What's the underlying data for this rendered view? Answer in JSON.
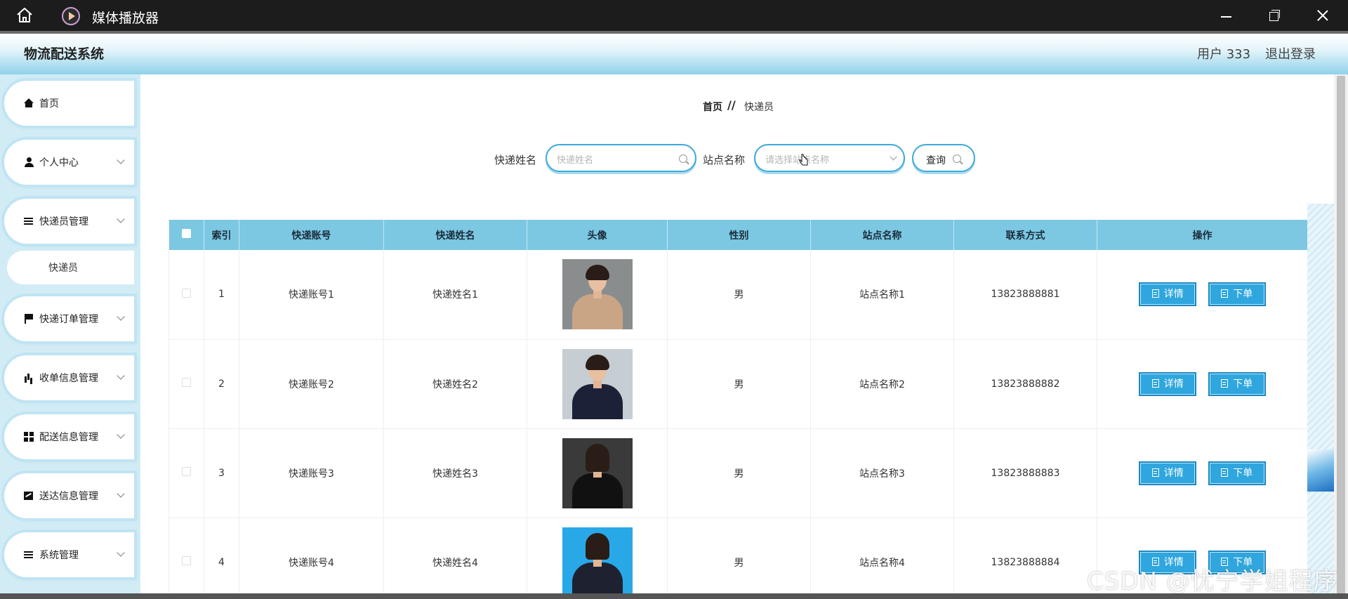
{
  "window": {
    "title": "媒体播放器"
  },
  "header": {
    "system_title": "物流配送系统",
    "user": "用户 333",
    "logout": "退出登录"
  },
  "sidebar": {
    "items": [
      {
        "label": "首页",
        "icon": "home-icon"
      },
      {
        "label": "个人中心",
        "icon": "user-icon"
      },
      {
        "label": "快递员管理",
        "icon": "list-icon"
      },
      {
        "label": "快递订单管理",
        "icon": "flag-icon"
      },
      {
        "label": "收单信息管理",
        "icon": "bar-chart-icon"
      },
      {
        "label": "配送信息管理",
        "icon": "grid-icon"
      },
      {
        "label": "送达信息管理",
        "icon": "line-chart-icon"
      },
      {
        "label": "系统管理",
        "icon": "list-icon"
      }
    ],
    "sub_items": [
      {
        "label": "快递员"
      }
    ]
  },
  "breadcrumb": {
    "home": "首页",
    "separator": "//",
    "current": "快递员"
  },
  "filters": {
    "name_label": "快递姓名",
    "name_placeholder": "快递姓名",
    "station_label": "站点名称",
    "station_placeholder": "请选择站点名称",
    "query_button": "查询"
  },
  "table": {
    "headers": [
      "索引",
      "快递账号",
      "快递姓名",
      "头像",
      "性别",
      "站点名称",
      "联系方式",
      "操作"
    ],
    "rows": [
      {
        "index": "1",
        "account": "快递账号1",
        "name": "快递姓名1",
        "gender": "男",
        "station": "站点名称1",
        "phone": "13823888881"
      },
      {
        "index": "2",
        "account": "快递账号2",
        "name": "快递姓名2",
        "gender": "男",
        "station": "站点名称2",
        "phone": "13823888882"
      },
      {
        "index": "3",
        "account": "快递账号3",
        "name": "快递姓名3",
        "gender": "男",
        "station": "站点名称3",
        "phone": "13823888883"
      },
      {
        "index": "4",
        "account": "快递账号4",
        "name": "快递姓名4",
        "gender": "男",
        "station": "站点名称4",
        "phone": "13823888884"
      }
    ],
    "actions": {
      "detail": "详情",
      "order": "下单"
    }
  },
  "watermark": "CSDN @忧宁学姐程序",
  "colors": {
    "accent": "#2fa6dd",
    "header_row": "#7cc8e3",
    "titlebar": "#1c1c1c"
  }
}
